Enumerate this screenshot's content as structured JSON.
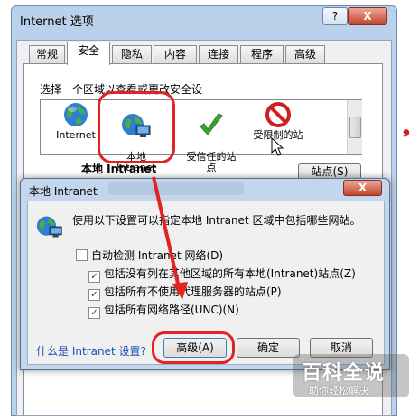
{
  "main_window": {
    "title": "Internet 选项",
    "help_label": "?",
    "close_label": "X",
    "tabs": [
      {
        "label": "常规"
      },
      {
        "label": "安全"
      },
      {
        "label": "隐私"
      },
      {
        "label": "内容"
      },
      {
        "label": "连接"
      },
      {
        "label": "程序"
      },
      {
        "label": "高级"
      }
    ],
    "zone_prompt": "选择一个区域以查看或更改安全设",
    "zones": [
      {
        "label": "Internet",
        "icon": "globe-icon"
      },
      {
        "label": "本地\nIntranet",
        "icon": "intranet-icon"
      },
      {
        "label": "受信任的站\n点",
        "icon": "checkmark-icon"
      },
      {
        "label": "受限制的站",
        "icon": "restricted-icon"
      }
    ],
    "zone_heading": "本地 Intranet",
    "sites_button": "站点(S)"
  },
  "dialog": {
    "title": "本地 Intranet",
    "close_label": "X",
    "description": "使用以下设置可以指定本地 Intranet 区域中包括哪些网站。",
    "auto_detect": {
      "label": "自动检测 Intranet 网络(D)",
      "checked": false
    },
    "options": [
      {
        "label": "包括没有列在其他区域的所有本地(Intranet)站点(Z)",
        "checked": true
      },
      {
        "label": "包括所有不使用代理服务器的站点(P)",
        "checked": true
      },
      {
        "label": "包括所有网络路径(UNC)(N)",
        "checked": true
      }
    ],
    "link": "什么是 Intranet 设置?",
    "advanced_button": "高级(A)",
    "ok_button": "确定",
    "cancel_button": "取消"
  },
  "watermark": {
    "main": "百科全说",
    "sub": "助你轻松解决"
  },
  "colors": {
    "annotation": "#e32222",
    "link": "#1a4fb6"
  }
}
